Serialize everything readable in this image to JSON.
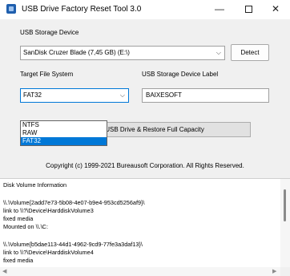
{
  "window": {
    "title": "USB Drive Factory Reset Tool 3.0",
    "minimize": "—",
    "close": "✕"
  },
  "device": {
    "label": "USB Storage Device",
    "selected": "SanDisk Cruzer Blade (7,45 GB) (E:\\)",
    "detect_label": "Detect"
  },
  "filesystem": {
    "label": "Target File System",
    "selected": "FAT32",
    "options": [
      "NTFS",
      "RAW",
      "FAT32"
    ]
  },
  "volume": {
    "label": "USB Storage Device Label",
    "value": "BAIXESOFT"
  },
  "reset_label": "Reset USB Drive & Restore Full Capacity",
  "copyright": "Copyright (c) 1999-2021 Bureausoft Corporation. All Rights Reserved.",
  "log": {
    "lines": [
      "Disk Volume Information",
      "",
      "\\\\.\\Volume{2add7e73-5b08-4e07-b9e4-953cd5256af9}\\",
      "  link to \\\\?\\Device\\HarddiskVolume3",
      "  fixed media",
      "  Mounted on \\\\.\\C:",
      "",
      "\\\\.\\Volume{b5dae113-44d1-4962-9cd9-77fe3a3daf13}\\",
      "  link to \\\\?\\Device\\HarddiskVolume4",
      "  fixed media"
    ]
  },
  "colors": {
    "accent": "#0078d7",
    "panel": "#f0f0f0"
  }
}
